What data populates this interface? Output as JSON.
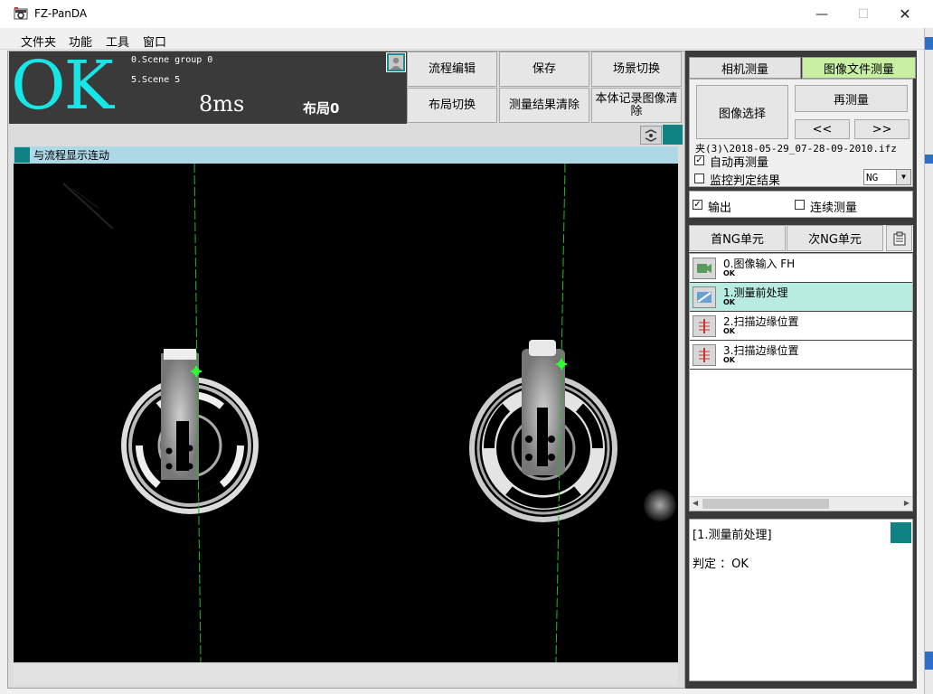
{
  "window": {
    "title": "FZ-PanDA"
  },
  "menu": [
    "文件夹",
    "功能",
    "工具",
    "窗口"
  ],
  "status": {
    "result": "OK",
    "scene_group": "0.Scene group 0",
    "scene": "5.Scene 5",
    "time": "8ms",
    "layout": "布局0"
  },
  "toolbar": {
    "flow_edit": "流程编辑",
    "save": "保存",
    "scene_switch": "场景切换",
    "layout_switch": "布局切换",
    "clear_results": "测量结果清除",
    "record_image_clear": "本体记录图像清除"
  },
  "image_panel": {
    "header": "与流程显示连动"
  },
  "right_panel": {
    "tabs": [
      "相机测量",
      "图像文件测量"
    ],
    "active_tab": 1,
    "image_select": "图像选择",
    "remeasure": "再测量",
    "prev": "<<",
    "next": ">>",
    "file_path": "夹(3)\\2018-05-29_07-28-09-2010.ifz",
    "auto_remeasure": {
      "label": "自动再测量",
      "checked": true
    },
    "monitor_judge": {
      "label": "监控判定结果",
      "checked": false
    },
    "ng_select": "NG",
    "output": {
      "label": "输出",
      "checked": true
    },
    "continuous": {
      "label": "连续测量",
      "checked": false
    },
    "first_ng": "首NG单元",
    "next_ng": "次NG单元"
  },
  "units": [
    {
      "name": "0.图像输入 FH",
      "status": "OK",
      "icon": "camera-input-icon",
      "selected": false
    },
    {
      "name": "1.测量前处理",
      "status": "OK",
      "icon": "preprocess-icon",
      "selected": true
    },
    {
      "name": "2.扫描边缘位置",
      "status": "OK",
      "icon": "edge-scan-icon",
      "selected": false
    },
    {
      "name": "3.扫描边缘位置",
      "status": "OK",
      "icon": "edge-scan-icon",
      "selected": false
    }
  ],
  "detail": {
    "title": "[1.测量前处理]",
    "result": "判定 ：OK"
  },
  "colors": {
    "ok_text": "#16e6e6",
    "teal": "#0e8383",
    "active_tab": "#c9efa3",
    "selected_row": "#b8ece0",
    "measure_line": "#1fbf1f"
  }
}
